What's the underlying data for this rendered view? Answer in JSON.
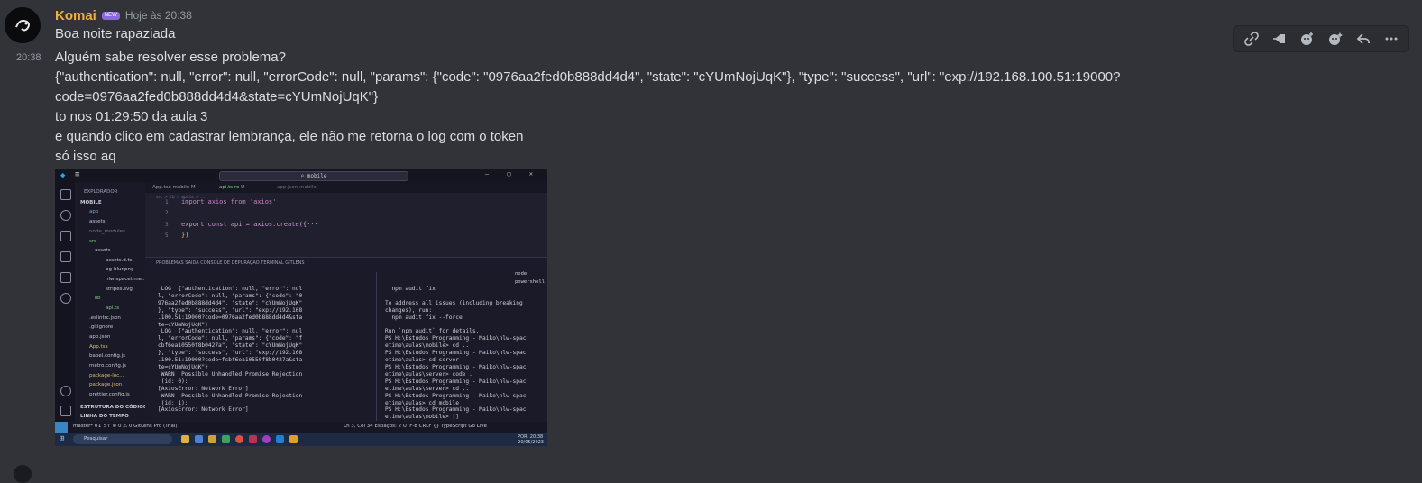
{
  "message": {
    "username": "Komai",
    "badge": "NEW",
    "timestamp": "Hoje às 20:38",
    "first_line": "Boa noite rapaziada",
    "side_time": "20:38",
    "lines": [
      "Alguém sabe resolver esse problema?",
      "{\"authentication\": null, \"error\": null, \"errorCode\": null, \"params\": {\"code\": \"0976aa2fed0b888dd4d4\", \"state\": \"cYUmNojUqK\"}, \"type\": \"success\", \"url\": \"exp://192.168.100.51:19000?",
      "code=0976aa2fed0b888dd4d4&state=cYUmNojUqK\"}",
      "to nos 01:29:50 da aula 3",
      "e quando clico em cadastrar lembrança, ele não me retorna o log com o token",
      "só isso aq"
    ]
  },
  "toolbar_icons": [
    "link-icon",
    "pin-icon",
    "add-reaction-icon",
    "super-reaction-icon",
    "reply-icon",
    "more-icon"
  ],
  "screenshot": {
    "search": "mobile",
    "explorer_title": "EXPLORADOR",
    "project": "MOBILE",
    "tree": [
      "app",
      "assets",
      "node_modules",
      "src",
      "assets",
      "assets.d.ts",
      "bg-blur.png",
      "nlw-spacetime...",
      "stripes.svg",
      "lib",
      "api.ts",
      ".eslintrc.json",
      ".gitignore",
      "app.json",
      "App.tsx",
      "babel.config.js",
      "metro.config.js",
      "package-loc...",
      "package.json",
      "prettier.config.js"
    ],
    "outline": "ESTRUTURA DO CÓDIGO",
    "timeline": "LINHA DO TEMPO",
    "tabs": [
      "App.tsx mobile M",
      "api.ts ro U",
      "app.json mobile"
    ],
    "breadcrumb": "src > lib > api.ts > ...",
    "code": [
      {
        "n": "1",
        "text": "import axios from 'axios'"
      },
      {
        "n": "2",
        "text": ""
      },
      {
        "n": "3",
        "text": "export const api = axios.create({···"
      },
      {
        "n": "5",
        "text": "})"
      }
    ],
    "panel_tabs": "PROBLEMAS    SAÍDA    CONSOLE DE DEPURAÇÃO    TERMINAL    GITLENS",
    "terminal_left": " LOG  {\"authentication\": null, \"error\": nul\nl, \"errorCode\": null, \"params\": {\"code\": \"0\n976aa2fed0b888dd4d4\", \"state\": \"cYUmNojUqK\"\n}, \"type\": \"success\", \"url\": \"exp://192.168\n.100.51:19000?code=0976aa2fed0b888dd4d4&sta\nte=cYUmNojUqK\"}\n LOG  {\"authentication\": null, \"error\": nul\nl, \"errorCode\": null, \"params\": {\"code\": \"f\ncbf6ea10550f8b0427a\", \"state\": \"cYUmNojUqK\"\n}, \"type\": \"success\", \"url\": \"exp://192.168\n.100.51:19000?code=fcbf6ea10550f8b0427a&sta\nte=cYUmNojUqK\"}\n WARN  Possible Unhandled Promise Rejection\n (id: 0):\n[AxiosError: Network Error]\n WARN  Possible Unhandled Promise Rejection\n (id: 1):\n[AxiosError: Network Error]",
    "terminal_right": "  npm audit fix\n\nTo address all issues (including breaking\nchanges), run:\n  npm audit fix --force\n\nRun `npm audit` for details.\nPS H:\\Estudos Programming - Maiko\\nlw-spac\netime\\aulas\\mobile> cd ..\nPS H:\\Estudos Programming - Maiko\\nlw-spac\netime\\aulas> cd server\nPS H:\\Estudos Programming - Maiko\\nlw-spac\netime\\aulas\\server> code .\nPS H:\\Estudos Programming - Maiko\\nlw-spac\netime\\aulas\\server> cd ..\nPS H:\\Estudos Programming - Maiko\\nlw-spac\netime\\aulas> cd mobile\nPS H:\\Estudos Programming - Maiko\\nlw-spac\netime\\aulas\\mobile> []",
    "terminals": [
      "node",
      "powershell"
    ],
    "status_left": "master*   0↓ 5↑   ⊗ 0 ⚠ 0   GitLens Pro (Trial)",
    "status_right": "Ln 3, Col 34   Espaços: 2   UTF-8   CRLF   {} TypeScript   Go Live",
    "taskbar_search": "Pesquisar",
    "tray": "POR  20:38\n20/05/2023"
  }
}
